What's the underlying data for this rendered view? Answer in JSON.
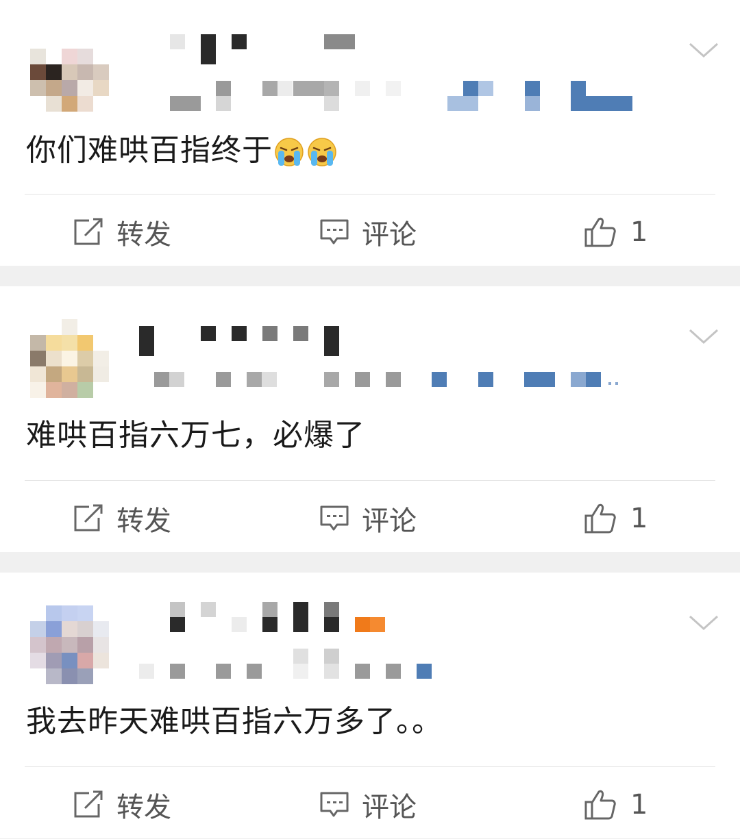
{
  "posts": [
    {
      "text": "你们难哄百指终于",
      "emoji": [
        "crying-emoji",
        "crying-emoji"
      ],
      "actions": {
        "forward": "转发",
        "comment": "评论",
        "like_count": "1"
      }
    },
    {
      "text": "难哄百指六万七，必爆了",
      "emoji": [],
      "actions": {
        "forward": "转发",
        "comment": "评论",
        "like_count": "1"
      }
    },
    {
      "text": "我去昨天难哄百指六万多了。。",
      "emoji": [],
      "actions": {
        "forward": "转发",
        "comment": "评论",
        "like_count": "1"
      }
    }
  ],
  "colors": {
    "page_bg": "#f0f0f0",
    "card_bg": "#ffffff",
    "text": "#1a1a1a",
    "action_text": "#555555",
    "redaction_blue": "#4f7db5",
    "redaction_orange": "#f07a1a"
  },
  "icons": [
    "forward-icon",
    "comment-icon",
    "thumbs-up-icon",
    "chevron-down-icon",
    "crying-emoji-icon"
  ]
}
